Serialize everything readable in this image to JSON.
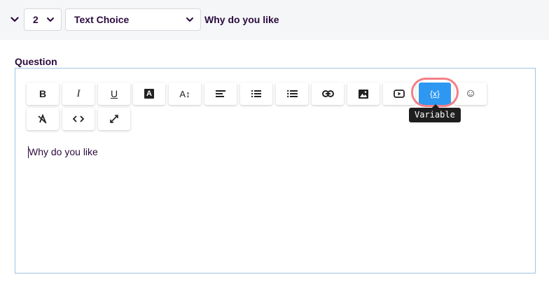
{
  "header": {
    "collapse_icon": "chevron-down-icon",
    "question_number": "2",
    "question_type": "Text Choice",
    "question_title": "Why do you like"
  },
  "editor": {
    "label": "Question",
    "content": "Why do you like",
    "toolbar": {
      "bold": "B",
      "italic": "I",
      "underline": "U",
      "text_color": "A",
      "font_size": "A↕",
      "variable": "{x}",
      "emoji": "☺"
    },
    "tooltip": "Variable",
    "colors": {
      "accent": "#2e97f2",
      "highlight_ring": "#f47f86",
      "text": "#2b0a3d"
    }
  }
}
